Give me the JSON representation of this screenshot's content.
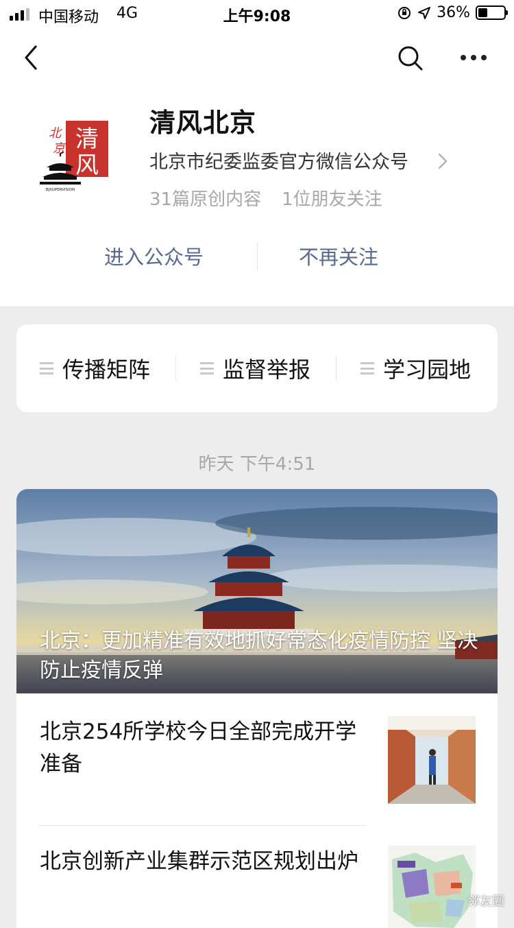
{
  "status_bar": {
    "carrier": "中国移动",
    "network": "4G",
    "time": "上午9:08",
    "battery": "36%",
    "battery_level": 0.36
  },
  "nav": {
    "icons": [
      "back-icon",
      "search-icon",
      "more-icon"
    ]
  },
  "account": {
    "name": "清风北京",
    "description": "北京市纪委监委官方微信公众号",
    "original_count": "31篇原创内容",
    "friends_following": "1位朋友关注",
    "logo_chars": "北京清风",
    "logo_caption": "BJSUPERVISION"
  },
  "actions": {
    "enter": "进入公众号",
    "unfollow": "不再关注"
  },
  "menu": {
    "items": [
      {
        "label": "传播矩阵"
      },
      {
        "label": "监督举报"
      },
      {
        "label": "学习园地"
      }
    ]
  },
  "feed": {
    "timestamp": "昨天 下午4:51",
    "cover": {
      "title": "北京：更加精准有效地抓好常态化疫情防控 坚决防止疫情反弹"
    },
    "items": [
      {
        "title": "北京254所学校今日全部完成开学准备"
      },
      {
        "title": "北京创新产业集群示范区规划出炉"
      }
    ]
  },
  "watermark": "邻友圈"
}
